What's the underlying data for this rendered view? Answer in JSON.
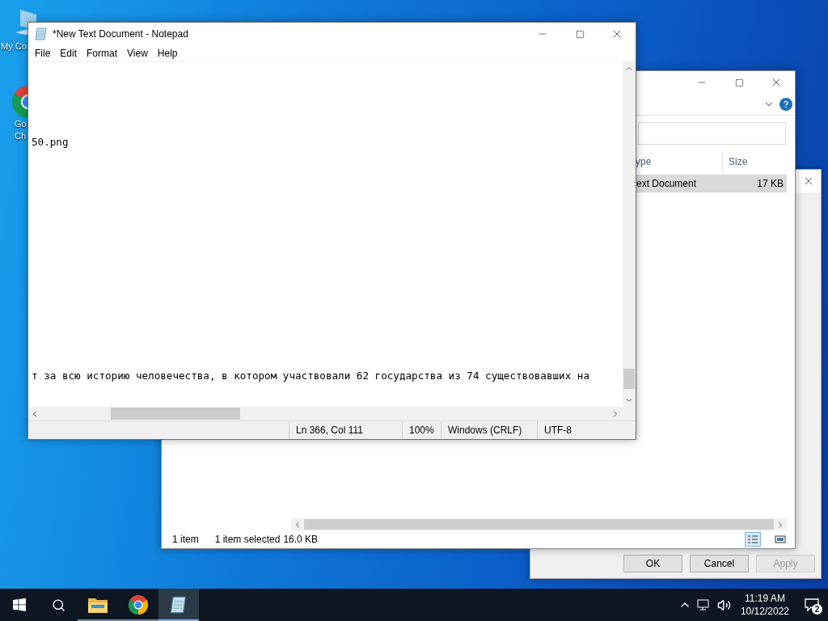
{
  "desktop_icons": [
    {
      "kind": "computer",
      "lines": [
        "My Co"
      ]
    },
    {
      "kind": "browser",
      "lines": [
        "Go",
        "Ch"
      ]
    }
  ],
  "dialog": {
    "buttons": [
      {
        "label": "OK",
        "disabled": false
      },
      {
        "label": "Cancel",
        "disabled": false
      },
      {
        "label": "Apply",
        "disabled": true
      }
    ]
  },
  "explorer": {
    "columns": [
      {
        "label": "ype"
      },
      {
        "label": "Size"
      }
    ],
    "rows": [
      {
        "cells": [
          "ext Document",
          "17 KB"
        ],
        "selected": true
      }
    ],
    "status": [
      "1 item",
      "1 item selected",
      "16.0 KB"
    ],
    "views": [
      {
        "kind": "details",
        "selected": true
      },
      {
        "kind": "tiles",
        "selected": false
      }
    ]
  },
  "notepad": {
    "title": "*New Text Document - Notepad",
    "menu": [
      "File",
      "Edit",
      "Format",
      "View",
      "Help"
    ],
    "lines": [
      {
        "text": "50.png"
      },
      {
        "text": "т за всю историю человечества, в котором участвовали 62 государства из 74 существовавших на"
      }
    ],
    "status": [
      "Ln 366, Col 111",
      "100%",
      "Windows (CRLF)",
      "UTF-8"
    ]
  },
  "taskbar": {
    "apps": [
      {
        "kind": "explorer",
        "active": false
      },
      {
        "kind": "browser",
        "active": false
      },
      {
        "kind": "notepad",
        "active": true
      }
    ],
    "time": "11:19 AM",
    "date": "10/12/2022",
    "notifications": "2"
  }
}
